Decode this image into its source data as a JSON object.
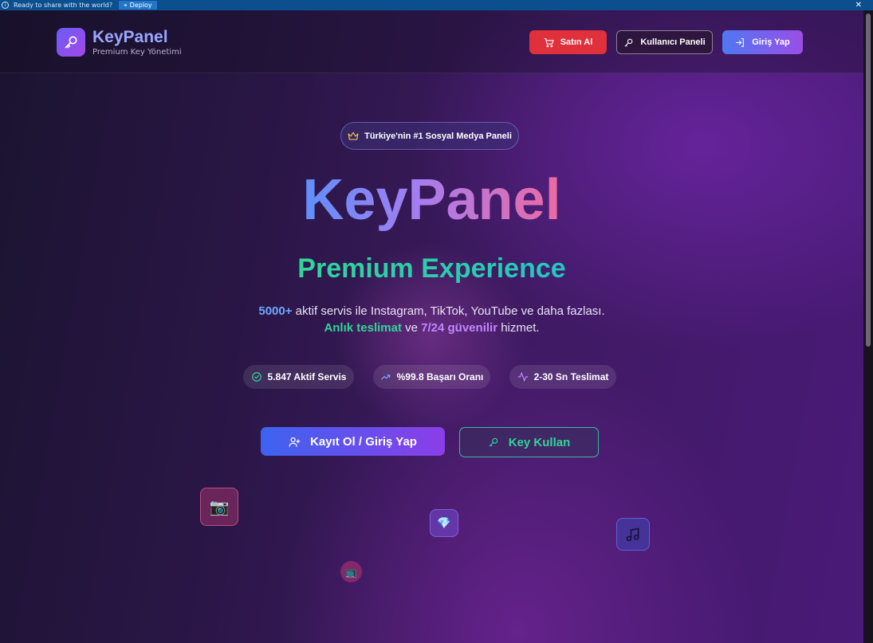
{
  "topbar": {
    "message": "Ready to share with the world?",
    "deploy_label": "Deploy",
    "close_glyph": "✕"
  },
  "brand": {
    "name": "KeyPanel",
    "subtitle": "Premium Key Yönetimi",
    "logo_icon": "key-icon"
  },
  "nav": {
    "buy_label": "Satın Al",
    "panel_label": "Kullanıcı Paneli",
    "login_label": "Giriş Yap"
  },
  "hero": {
    "badge": "Türkiye'nin #1 Sosyal Medya Paneli",
    "title": "KeyPanel",
    "subtitle": "Premium Experience",
    "desc_count": "5000+",
    "desc_line1_rest": " aktif servis ile Instagram, TikTok, YouTube ve daha fazlası.",
    "desc_instant": "Anlık teslimat",
    "desc_and": " ve ",
    "desc_reliable": "7/24 güvenilir",
    "desc_service": " hizmet."
  },
  "stats": [
    {
      "label": "5.847 Aktif Servis",
      "icon": "check-circle-icon"
    },
    {
      "label": "%99.8 Başarı Oranı",
      "icon": "trending-up-icon"
    },
    {
      "label": "2-30 Sn Teslimat",
      "icon": "activity-icon"
    }
  ],
  "cta": {
    "register_label": "Kayıt Ol / Giriş Yap",
    "key_label": "Key Kullan"
  },
  "floating": {
    "camera": "📷",
    "gem": "💎",
    "tv": "📺"
  },
  "colors": {
    "buy_button": "#e0303b",
    "accent_green": "#34d399",
    "accent_blue": "#6ea8ff",
    "accent_purple": "#c085ff"
  }
}
